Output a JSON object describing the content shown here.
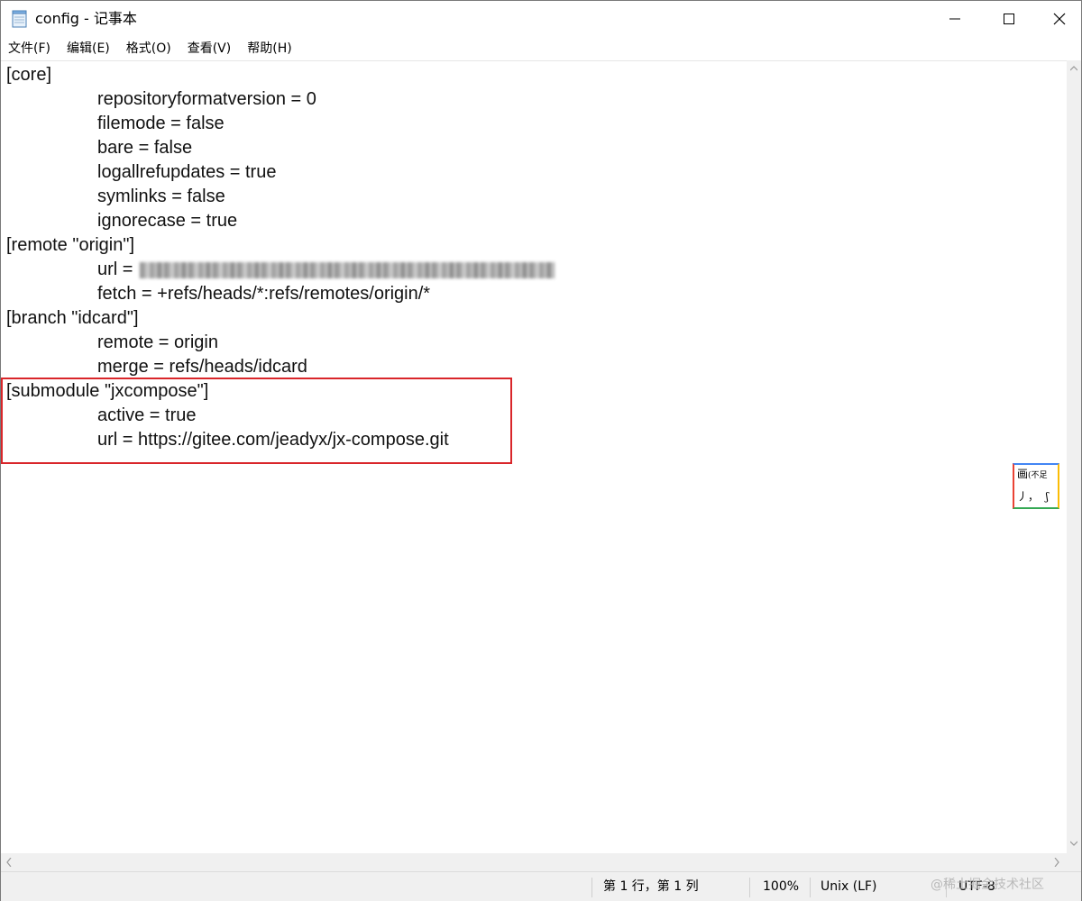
{
  "window": {
    "title": "config - 记事本",
    "icon": "notepad-icon",
    "controls": [
      "minimize-icon",
      "maximize-icon",
      "close-icon"
    ]
  },
  "menu": {
    "items": [
      "文件(F)",
      "编辑(E)",
      "格式(O)",
      "查看(V)",
      "帮助(H)"
    ]
  },
  "editor": {
    "lines": [
      "[core]",
      "repositoryformatversion = 0",
      "filemode = false",
      "bare = false",
      "logallrefupdates = true",
      "symlinks = false",
      "ignorecase = true",
      "[remote \"origin\"]",
      "url = ",
      "fetch = +refs/heads/*:refs/remotes/origin/*",
      "[branch \"idcard\"]",
      "remote = origin",
      "merge = refs/heads/idcard",
      "[submodule \"jxcompose\"]",
      "active = true",
      "url = https://gitee.com/jeadyx/jx-compose.git"
    ],
    "highlight_color": "#d9262a"
  },
  "status": {
    "position": "第 1 行，第 1 列",
    "zoom": "100%",
    "line_ending": "Unix (LF)",
    "encoding": "UTF-8"
  },
  "watermark": "@稀土掘金技术社区",
  "ime": {
    "top_char": "画",
    "top_small": "(不足",
    "bottom": "丿，  ʃ"
  }
}
